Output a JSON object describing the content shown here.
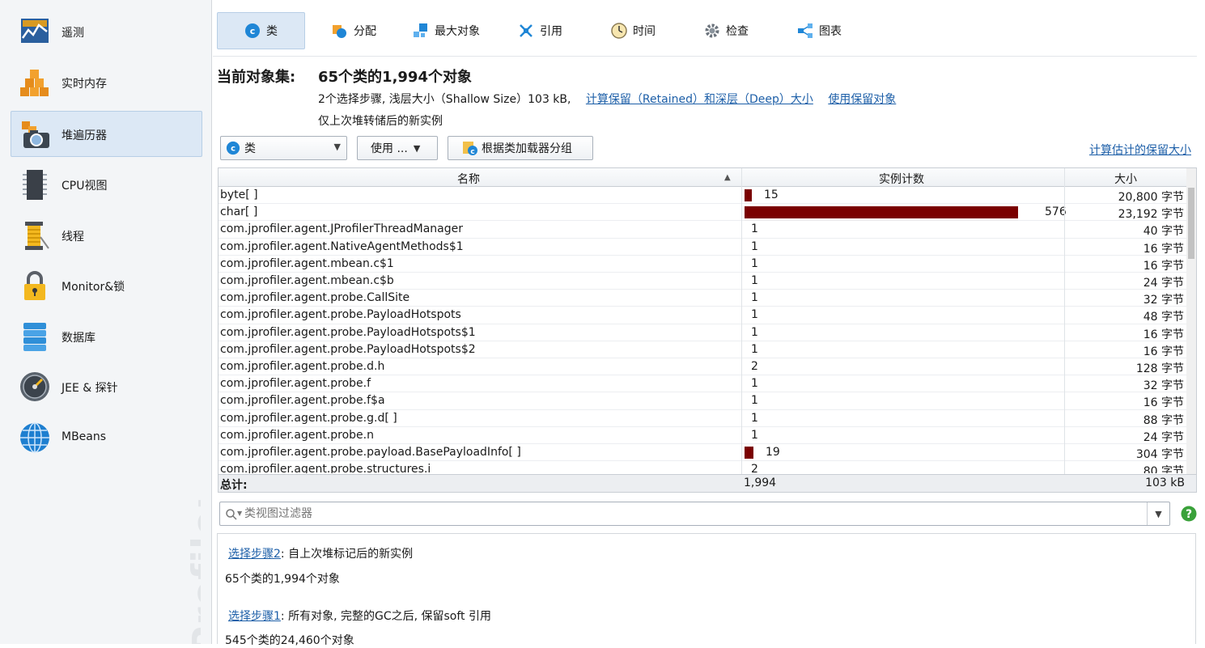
{
  "sidebar": {
    "items": [
      {
        "label": "遥测",
        "icon": "telemetry-icon"
      },
      {
        "label": "实时内存",
        "icon": "live-memory-icon"
      },
      {
        "label": "堆遍历器",
        "icon": "heap-walker-icon"
      },
      {
        "label": "CPU视图",
        "icon": "cpu-icon"
      },
      {
        "label": "线程",
        "icon": "threads-icon"
      },
      {
        "label": "Monitor&锁",
        "icon": "lock-icon"
      },
      {
        "label": "数据库",
        "icon": "database-icon"
      },
      {
        "label": "JEE & 探针",
        "icon": "gauge-icon"
      },
      {
        "label": "MBeans",
        "icon": "globe-icon"
      }
    ],
    "active_index": 2,
    "brand_text": "Profiler"
  },
  "tabs": [
    {
      "label": "类",
      "icon": "class-icon"
    },
    {
      "label": "分配",
      "icon": "allocation-icon"
    },
    {
      "label": "最大对象",
      "icon": "biggest-objects-icon"
    },
    {
      "label": "引用",
      "icon": "references-icon"
    },
    {
      "label": "时间",
      "icon": "clock-icon"
    },
    {
      "label": "检查",
      "icon": "gear-icon"
    },
    {
      "label": "图表",
      "icon": "graph-icon"
    }
  ],
  "object_set": {
    "title": "当前对象集:",
    "value": "65个类的1,994个对象",
    "steps_text": "2个选择步骤, 浅层大小（Shallow Size）103 kB,",
    "retained_link": "计算保留（Retained）和深层（Deep）大小",
    "use_retained_link": "使用保留对象",
    "new_only": "仅上次堆转储后的新实例"
  },
  "toolbar": {
    "group_by": "类",
    "use_label": "使用 ...",
    "classloader_button": "根据类加载器分组",
    "estimate_link": "计算估计的保留大小"
  },
  "table": {
    "columns": [
      "名称",
      "实例计数",
      "大小"
    ],
    "max_count": 576,
    "rows": [
      {
        "name": "byte[ ]",
        "count": 15,
        "count_text": "15",
        "size": "20,800 字节"
      },
      {
        "name": "char[ ]",
        "count": 576,
        "count_text": "576",
        "size": "23,192 字节"
      },
      {
        "name": "com.jprofiler.agent.JProfilerThreadManager",
        "count": 1,
        "count_text": "1",
        "size": "40 字节"
      },
      {
        "name": "com.jprofiler.agent.NativeAgentMethods$1",
        "count": 1,
        "count_text": "1",
        "size": "16 字节"
      },
      {
        "name": "com.jprofiler.agent.mbean.c$1",
        "count": 1,
        "count_text": "1",
        "size": "16 字节"
      },
      {
        "name": "com.jprofiler.agent.mbean.c$b",
        "count": 1,
        "count_text": "1",
        "size": "24 字节"
      },
      {
        "name": "com.jprofiler.agent.probe.CallSite",
        "count": 1,
        "count_text": "1",
        "size": "32 字节"
      },
      {
        "name": "com.jprofiler.agent.probe.PayloadHotspots",
        "count": 1,
        "count_text": "1",
        "size": "48 字节"
      },
      {
        "name": "com.jprofiler.agent.probe.PayloadHotspots$1",
        "count": 1,
        "count_text": "1",
        "size": "16 字节"
      },
      {
        "name": "com.jprofiler.agent.probe.PayloadHotspots$2",
        "count": 1,
        "count_text": "1",
        "size": "16 字节"
      },
      {
        "name": "com.jprofiler.agent.probe.d.h",
        "count": 2,
        "count_text": "2",
        "size": "128 字节"
      },
      {
        "name": "com.jprofiler.agent.probe.f",
        "count": 1,
        "count_text": "1",
        "size": "32 字节"
      },
      {
        "name": "com.jprofiler.agent.probe.f$a",
        "count": 1,
        "count_text": "1",
        "size": "16 字节"
      },
      {
        "name": "com.jprofiler.agent.probe.g.d[ ]",
        "count": 1,
        "count_text": "1",
        "size": "88 字节"
      },
      {
        "name": "com.jprofiler.agent.probe.n",
        "count": 1,
        "count_text": "1",
        "size": "24 字节"
      },
      {
        "name": "com.jprofiler.agent.probe.payload.BasePayloadInfo[ ]",
        "count": 19,
        "count_text": "19",
        "size": "304 字节"
      },
      {
        "name": "com.jprofiler.agent.probe.structures.i",
        "count": 2,
        "count_text": "2",
        "size": "80 字节"
      }
    ],
    "total_label": "总计:",
    "total_count": "1,994",
    "total_size": "103 kB"
  },
  "filter": {
    "placeholder": "类视图过滤器"
  },
  "details": [
    {
      "link": "选择步骤2",
      "text": ": 自上次堆标记后的新实例",
      "summary": "65个类的1,994个对象"
    },
    {
      "link": "选择步骤1",
      "text": ": 所有对象, 完整的GC之后, 保留soft 引用",
      "summary": "545个类的24,460个对象"
    }
  ],
  "colors": {
    "bar": "#7a0000",
    "accent": "#1d5fa8",
    "active_bg": "#dce8f5",
    "help": "#3aa13a"
  }
}
